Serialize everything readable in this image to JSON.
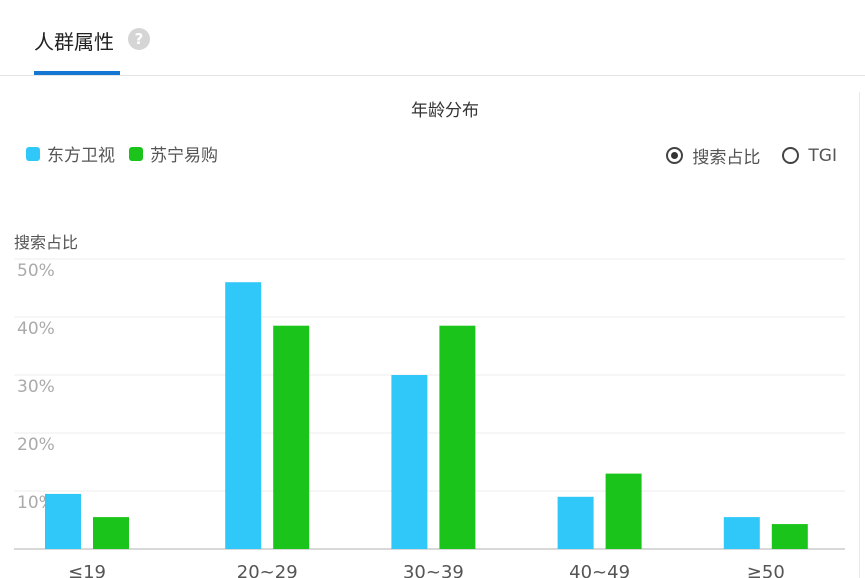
{
  "header": {
    "title": "人群属性",
    "help_icon": "?"
  },
  "controls": {
    "radio_options": [
      {
        "label": "搜索占比",
        "selected": true
      },
      {
        "label": "TGI",
        "selected": false
      }
    ]
  },
  "colors": {
    "series1": "#30c8f8",
    "series2": "#1bc41b",
    "accent": "#1677d2"
  },
  "chart_data": {
    "type": "bar",
    "title": "年龄分布",
    "ylabel": "搜索占比",
    "xlabel": "",
    "categories": [
      "≤19",
      "20~29",
      "30~39",
      "40~49",
      "≥50"
    ],
    "series": [
      {
        "name": "东方卫视",
        "values": [
          9.5,
          46,
          30,
          9,
          5.5
        ]
      },
      {
        "name": "苏宁易购",
        "values": [
          5.5,
          38.5,
          38.5,
          13,
          4.3
        ]
      }
    ],
    "ylim": [
      0,
      50
    ],
    "yticks": [
      "50%",
      "40%",
      "30%",
      "20%",
      "10%"
    ],
    "legend": "top-left",
    "grid": true
  }
}
